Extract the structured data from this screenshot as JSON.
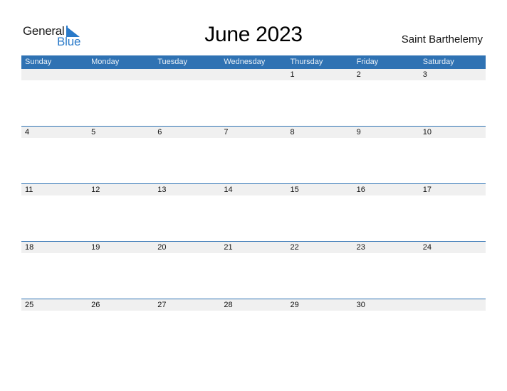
{
  "logo": {
    "word1": "General",
    "word2": "Blue"
  },
  "title": "June 2023",
  "country": "Saint Barthelemy",
  "colors": {
    "accent": "#2f72b3",
    "strip": "#f0f0f0",
    "logo_blue": "#2a7ac9"
  },
  "weekdays": [
    "Sunday",
    "Monday",
    "Tuesday",
    "Wednesday",
    "Thursday",
    "Friday",
    "Saturday"
  ],
  "weeks": [
    [
      "",
      "",
      "",
      "",
      "1",
      "2",
      "3"
    ],
    [
      "4",
      "5",
      "6",
      "7",
      "8",
      "9",
      "10"
    ],
    [
      "11",
      "12",
      "13",
      "14",
      "15",
      "16",
      "17"
    ],
    [
      "18",
      "19",
      "20",
      "21",
      "22",
      "23",
      "24"
    ],
    [
      "25",
      "26",
      "27",
      "28",
      "29",
      "30",
      ""
    ]
  ]
}
